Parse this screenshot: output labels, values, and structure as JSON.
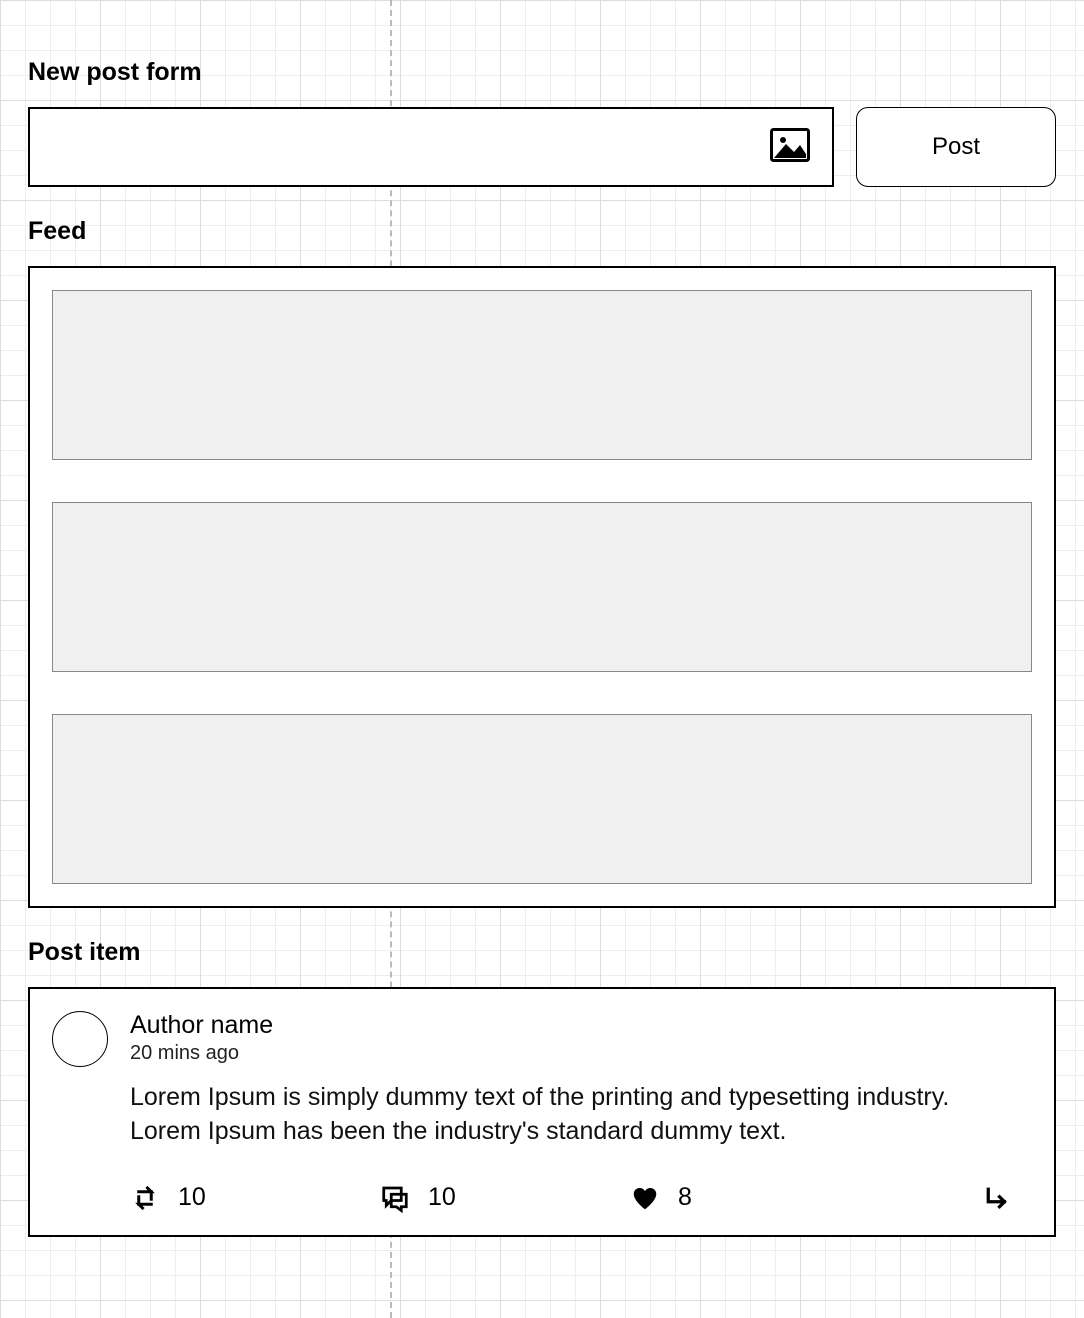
{
  "sections": {
    "new_post": "New post form",
    "feed": "Feed",
    "post_item": "Post item"
  },
  "new_post": {
    "post_button": "Post"
  },
  "post": {
    "author": "Author name",
    "time": "20 mins ago",
    "text": "Lorem Ipsum is simply dummy text of the printing and typesetting industry. Lorem Ipsum has been the industry's standard dummy text.",
    "repost_count": "10",
    "comment_count": "10",
    "like_count": "8"
  }
}
